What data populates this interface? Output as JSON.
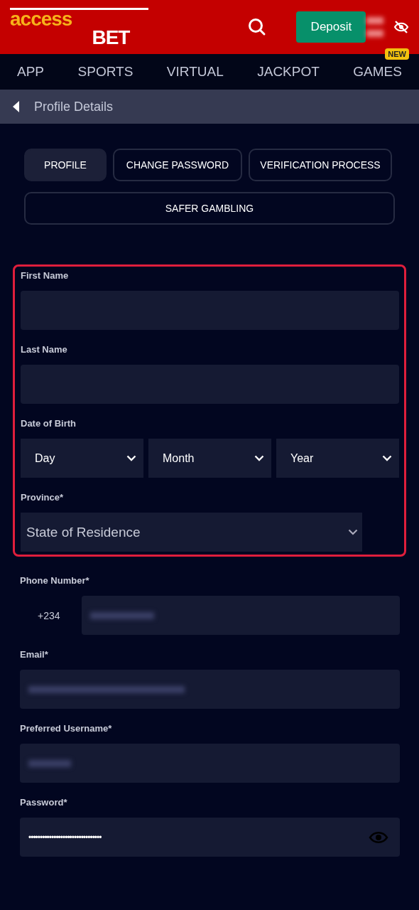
{
  "header": {
    "logo": {
      "accent": "access",
      "rest": "BET"
    },
    "deposit_button": "Deposit",
    "balance_hidden": true
  },
  "nav": [
    {
      "label": "APP"
    },
    {
      "label": "SPORTS"
    },
    {
      "label": "VIRTUAL"
    },
    {
      "label": "JACKPOT"
    },
    {
      "label": "GAMES",
      "badge": "NEW"
    }
  ],
  "page_title": "Profile Details",
  "tabs": [
    {
      "label": "PROFILE",
      "selected": true
    },
    {
      "label": "CHANGE PASSWORD",
      "selected": false
    },
    {
      "label": "VERIFICATION PROCESS",
      "selected": false
    },
    {
      "label": "SAFER GAMBLING",
      "selected": false
    }
  ],
  "highlighted_section": {
    "highlighted": true,
    "fields": [
      {
        "kind": "text",
        "label": "First Name"
      },
      {
        "kind": "text",
        "label": "Last Name"
      },
      {
        "kind": "selects",
        "label": "Date of Birth",
        "options": [
          "Day",
          "Month",
          "Year"
        ]
      },
      {
        "kind": "select",
        "label": "Province*",
        "value": "State of Residence"
      }
    ]
  },
  "fields": [
    {
      "kind": "phone",
      "label": "Phone Number*",
      "prefix": "+234",
      "blurred": true
    },
    {
      "kind": "text",
      "label": "Email*",
      "blurred": true
    },
    {
      "kind": "text",
      "label": "Preferred Username*",
      "blurred": true
    },
    {
      "kind": "password",
      "label": "Password*",
      "value": "••••••••••••••••••••••••••••••••"
    }
  ]
}
